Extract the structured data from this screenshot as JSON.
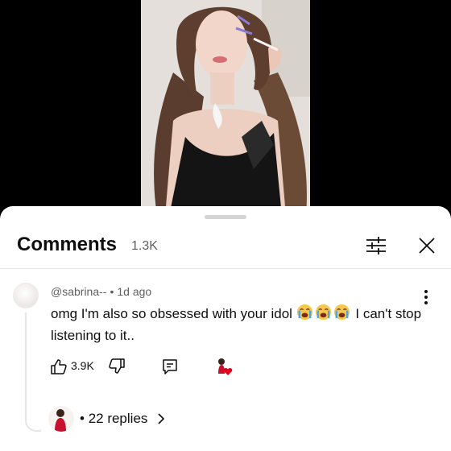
{
  "comments_panel": {
    "title": "Comments",
    "count": "1.3K"
  },
  "comment": {
    "author": "@sabrina--",
    "separator": "•",
    "time": "1d ago",
    "text_before": "omg I'm also so obsessed with your idol ",
    "emojis": [
      "loudly-crying-face",
      "loudly-crying-face",
      "loudly-crying-face"
    ],
    "text_after": " I can't stop listening to it..",
    "likes": "3.9K",
    "replies_label": "22 replies"
  },
  "colors": {
    "sheet_background": "#ffffff",
    "video_background": "#000000",
    "secondary_text": "#606060",
    "heart": "#e0001b"
  }
}
